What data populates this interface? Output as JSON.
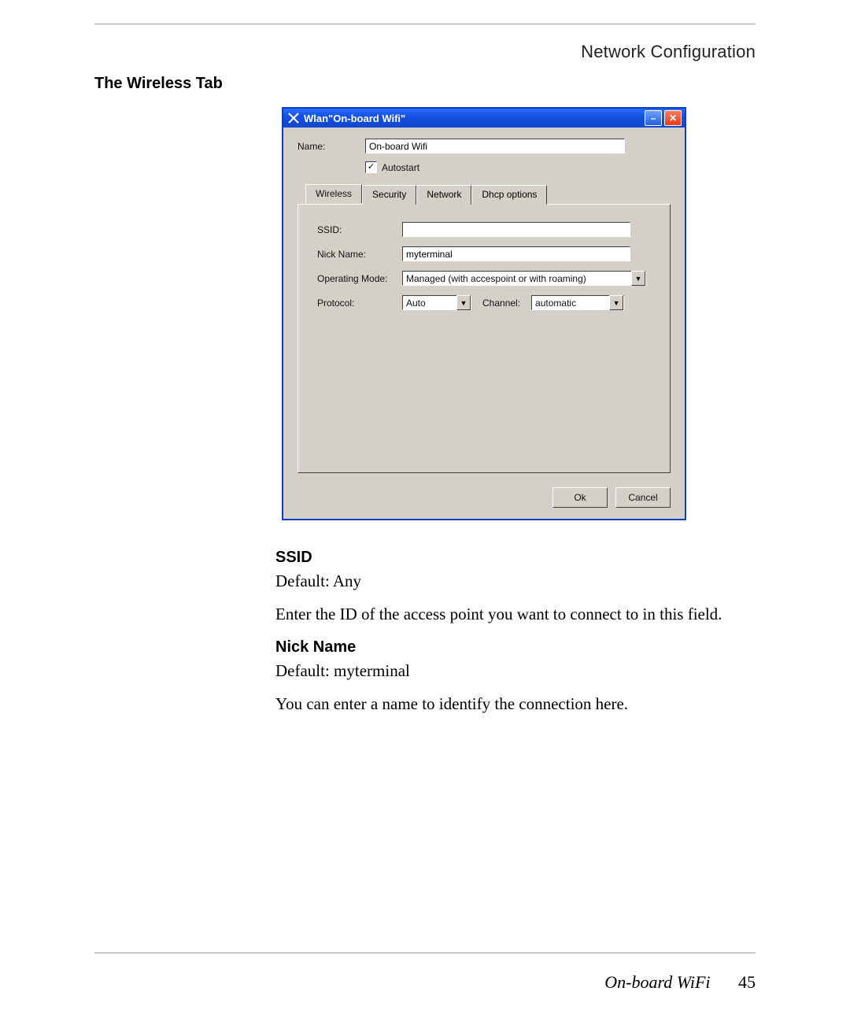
{
  "running_head": "Network Configuration",
  "section_title": "The Wireless Tab",
  "window": {
    "title": "Wlan\"On-board Wifi\"",
    "name_label": "Name:",
    "name_value": "On-board Wifi",
    "autostart_label": "Autostart",
    "autostart_checked": true,
    "tabs": [
      "Wireless",
      "Security",
      "Network",
      "Dhcp options"
    ],
    "active_tab": "Wireless",
    "fields": {
      "ssid_label": "SSID:",
      "ssid_value": "",
      "nick_label": "Nick Name:",
      "nick_value": "myterminal",
      "opmode_label": "Operating Mode:",
      "opmode_value": "Managed (with accespoint or with roaming)",
      "protocol_label": "Protocol:",
      "protocol_value": "Auto",
      "channel_label": "Channel:",
      "channel_value": "automatic"
    },
    "ok_label": "Ok",
    "cancel_label": "Cancel"
  },
  "body": {
    "ssid_head": "SSID",
    "ssid_default": "Default: Any",
    "ssid_text": "Enter the ID of the access point you want to connect to in this field.",
    "nick_head": "Nick Name",
    "nick_default": "Default: myterminal",
    "nick_text": "You can enter a name to identify the connection here."
  },
  "footer": {
    "section": "On-board WiFi",
    "page_number": "45"
  }
}
